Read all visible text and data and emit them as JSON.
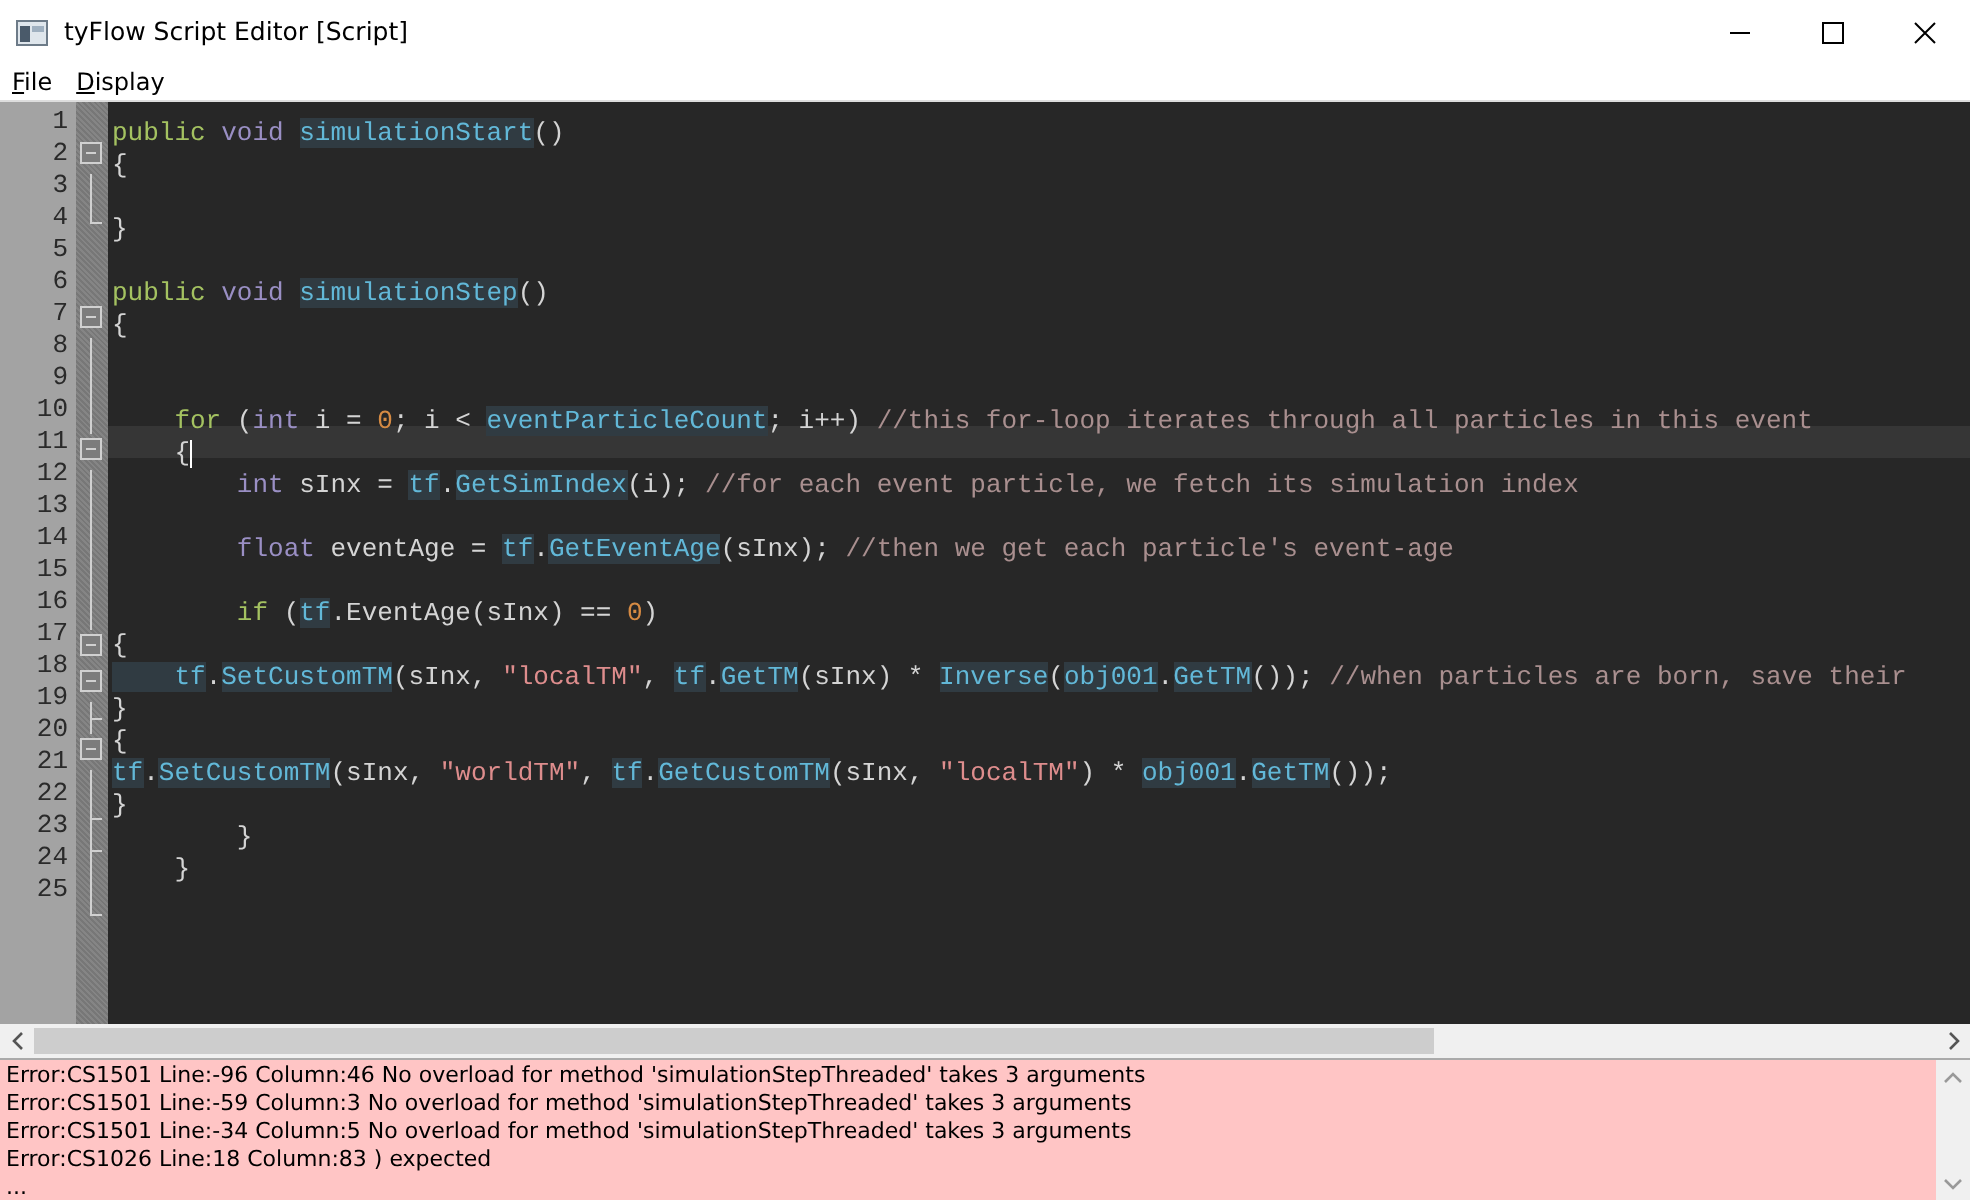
{
  "window": {
    "title": "tyFlow Script Editor [Script]"
  },
  "menu": [
    {
      "label": "File",
      "underline_first": true
    },
    {
      "label": "Display",
      "underline_first": true
    }
  ],
  "editor": {
    "lines": [
      {
        "number": "1",
        "kind": "none",
        "current": false,
        "tokens": [
          {
            "kind": "kw",
            "text": "public "
          },
          {
            "kind": "ty",
            "text": "void "
          },
          {
            "kind": "id",
            "text": "simulationStart"
          },
          {
            "kind": "p",
            "text": "()"
          }
        ]
      },
      {
        "number": "2",
        "kind": "open",
        "current": false,
        "tokens": [
          {
            "kind": "p",
            "text": "{"
          }
        ]
      },
      {
        "number": "3",
        "kind": "line",
        "current": false
      },
      {
        "number": "4",
        "kind": "end",
        "current": false,
        "tokens": [
          {
            "kind": "p",
            "text": "}"
          }
        ]
      },
      {
        "number": "5",
        "kind": "none",
        "current": false
      },
      {
        "number": "6",
        "kind": "none",
        "current": false,
        "tokens": [
          {
            "kind": "kw",
            "text": "public "
          },
          {
            "kind": "ty",
            "text": "void "
          },
          {
            "kind": "id",
            "text": "simulationStep"
          },
          {
            "kind": "p",
            "text": "()"
          }
        ]
      },
      {
        "number": "7",
        "kind": "open",
        "current": false,
        "tokens": [
          {
            "kind": "p",
            "text": "{"
          }
        ]
      },
      {
        "number": "8",
        "kind": "line",
        "current": false
      },
      {
        "number": "9",
        "kind": "line",
        "current": false
      },
      {
        "number": "10",
        "kind": "line",
        "current": false,
        "tokens": [
          {
            "kind": "kw",
            "text": "    for"
          },
          {
            "kind": "p",
            "text": " ("
          },
          {
            "kind": "ty",
            "text": "int"
          },
          {
            "kind": "p",
            "text": " i = "
          },
          {
            "kind": "n",
            "text": "0"
          },
          {
            "kind": "p",
            "text": "; i < "
          },
          {
            "kind": "id",
            "text": "eventParticleCount"
          },
          {
            "kind": "p",
            "text": "; i++) "
          },
          {
            "kind": "c",
            "text": "//this for-loop iterates through all particles in this event"
          }
        ]
      },
      {
        "number": "11",
        "kind": "open",
        "current": true,
        "caret": true,
        "tokens": [
          {
            "kind": "p",
            "text": "    {"
          }
        ]
      },
      {
        "number": "12",
        "kind": "line",
        "current": false,
        "tokens": [
          {
            "kind": "ty",
            "text": "        int"
          },
          {
            "kind": "p",
            "text": " sInx = "
          },
          {
            "kind": "id",
            "text": "tf"
          },
          {
            "kind": "p",
            "text": "."
          },
          {
            "kind": "id",
            "text": "GetSimIndex"
          },
          {
            "kind": "p",
            "text": "(i); "
          },
          {
            "kind": "c",
            "text": "//for each event particle, we fetch its simulation index"
          }
        ]
      },
      {
        "number": "13",
        "kind": "line",
        "current": false
      },
      {
        "number": "14",
        "kind": "line",
        "current": false,
        "tokens": [
          {
            "kind": "ty",
            "text": "        float"
          },
          {
            "kind": "p",
            "text": " eventAge = "
          },
          {
            "kind": "id",
            "text": "tf"
          },
          {
            "kind": "p",
            "text": "."
          },
          {
            "kind": "id",
            "text": "GetEventAge"
          },
          {
            "kind": "p",
            "text": "(sInx); "
          },
          {
            "kind": "c",
            "text": "//then we get each particle's event-age"
          }
        ]
      },
      {
        "number": "15",
        "kind": "line",
        "current": false
      },
      {
        "number": "16",
        "kind": "line",
        "current": false,
        "tokens": [
          {
            "kind": "kw",
            "text": "        if"
          },
          {
            "kind": "p",
            "text": " ("
          },
          {
            "kind": "id",
            "text": "tf"
          },
          {
            "kind": "p",
            "text": ".EventAge(sInx) == "
          },
          {
            "kind": "n",
            "text": "0"
          },
          {
            "kind": "p",
            "text": ")"
          }
        ]
      },
      {
        "number": "17",
        "kind": "open",
        "current": false,
        "tokens": [
          {
            "kind": "p",
            "text": "{"
          }
        ]
      },
      {
        "number": "18",
        "kind": "open",
        "current": false,
        "tokens": [
          {
            "kind": "id",
            "text": "    tf"
          },
          {
            "kind": "p",
            "text": "."
          },
          {
            "kind": "id",
            "text": "SetCustomTM"
          },
          {
            "kind": "p",
            "text": "(sInx, "
          },
          {
            "kind": "s",
            "text": "\"localTM\""
          },
          {
            "kind": "p",
            "text": ", "
          },
          {
            "kind": "id",
            "text": "tf"
          },
          {
            "kind": "p",
            "text": "."
          },
          {
            "kind": "id",
            "text": "GetTM"
          },
          {
            "kind": "p",
            "text": "(sInx) * "
          },
          {
            "kind": "id",
            "text": "Inverse"
          },
          {
            "kind": "p",
            "text": "("
          },
          {
            "kind": "id",
            "text": "obj001"
          },
          {
            "kind": "p",
            "text": "."
          },
          {
            "kind": "id",
            "text": "GetTM"
          },
          {
            "kind": "p",
            "text": "()); "
          },
          {
            "kind": "c",
            "text": "//when particles are born, save their"
          }
        ]
      },
      {
        "number": "19",
        "kind": "tee",
        "current": false,
        "tokens": [
          {
            "kind": "p",
            "text": "}"
          }
        ]
      },
      {
        "number": "20",
        "kind": "open",
        "current": false,
        "tokens": [
          {
            "kind": "p",
            "text": "{"
          }
        ]
      },
      {
        "number": "21",
        "kind": "line",
        "current": false,
        "tokens": [
          {
            "kind": "id",
            "text": "tf"
          },
          {
            "kind": "p",
            "text": "."
          },
          {
            "kind": "id",
            "text": "SetCustomTM"
          },
          {
            "kind": "p",
            "text": "(sInx, "
          },
          {
            "kind": "s",
            "text": "\"worldTM\""
          },
          {
            "kind": "p",
            "text": ", "
          },
          {
            "kind": "id",
            "text": "tf"
          },
          {
            "kind": "p",
            "text": "."
          },
          {
            "kind": "id",
            "text": "GetCustomTM"
          },
          {
            "kind": "p",
            "text": "(sInx, "
          },
          {
            "kind": "s",
            "text": "\"localTM\""
          },
          {
            "kind": "p",
            "text": ") * "
          },
          {
            "kind": "id",
            "text": "obj001"
          },
          {
            "kind": "p",
            "text": "."
          },
          {
            "kind": "id",
            "text": "GetTM"
          },
          {
            "kind": "p",
            "text": "());"
          }
        ]
      },
      {
        "number": "22",
        "kind": "tee",
        "current": false,
        "tokens": [
          {
            "kind": "p",
            "text": "}"
          }
        ]
      },
      {
        "number": "23",
        "kind": "tee",
        "current": false,
        "tokens": [
          {
            "kind": "p",
            "text": "        }"
          }
        ]
      },
      {
        "number": "24",
        "kind": "line",
        "current": false,
        "tokens": [
          {
            "kind": "p",
            "text": "    }"
          }
        ]
      },
      {
        "number": "25",
        "kind": "end",
        "current": false
      }
    ]
  },
  "errors": [
    "Error:CS1501 Line:-96 Column:46 No overload for method 'simulationStepThreaded' takes 3 arguments",
    "Error:CS1501 Line:-59 Column:3 No overload for method 'simulationStepThreaded' takes 3 arguments",
    "Error:CS1501 Line:-34 Column:5 No overload for method 'simulationStepThreaded' takes 3 arguments",
    "Error:CS1026 Line:18 Column:83 ) expected",
    "..."
  ]
}
